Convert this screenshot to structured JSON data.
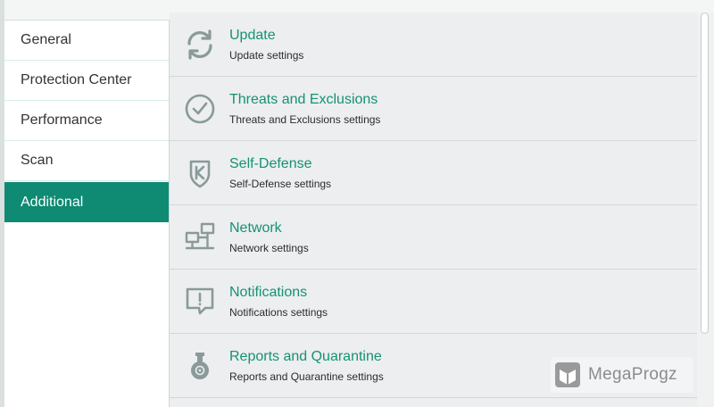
{
  "sidebar": {
    "items": [
      {
        "label": "General"
      },
      {
        "label": "Protection Center"
      },
      {
        "label": "Performance"
      },
      {
        "label": "Scan"
      },
      {
        "label": "Additional",
        "active": true
      }
    ]
  },
  "main": {
    "items": [
      {
        "icon": "refresh-icon",
        "title": "Update",
        "desc": "Update settings"
      },
      {
        "icon": "check-circle-icon",
        "title": "Threats and Exclusions",
        "desc": "Threats and Exclusions settings"
      },
      {
        "icon": "shield-k-icon",
        "title": "Self-Defense",
        "desc": "Self-Defense settings"
      },
      {
        "icon": "network-icon",
        "title": "Network",
        "desc": "Network settings"
      },
      {
        "icon": "alert-speech-icon",
        "title": "Notifications",
        "desc": "Notifications settings"
      },
      {
        "icon": "flask-biohazard-icon",
        "title": "Reports and Quarantine",
        "desc": "Reports and Quarantine settings"
      }
    ]
  },
  "watermark": {
    "text": "MegaProgz"
  },
  "colors": {
    "accent": "#0f8a73",
    "title_text": "#149275",
    "icon_gray": "#8a9a99",
    "list_background": "#eceeef"
  }
}
